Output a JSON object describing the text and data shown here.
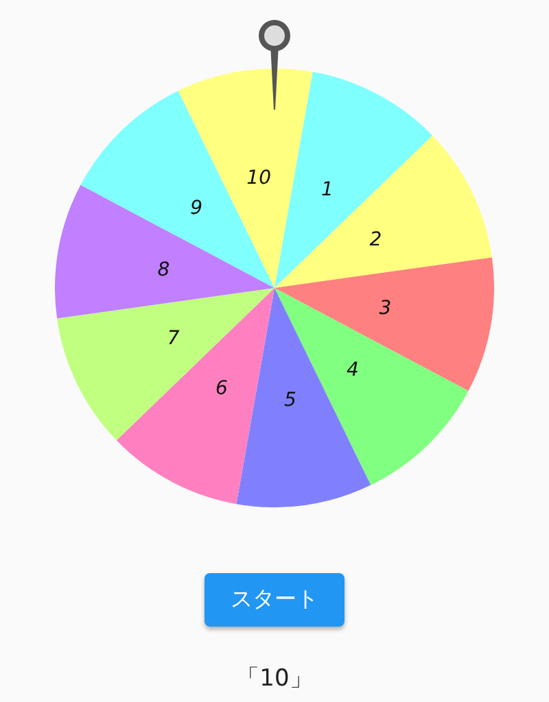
{
  "wheel": {
    "segments": [
      {
        "label": "1",
        "color": "#80ffff"
      },
      {
        "label": "2",
        "color": "#ffff80"
      },
      {
        "label": "3",
        "color": "#ff8080"
      },
      {
        "label": "4",
        "color": "#80ff80"
      },
      {
        "label": "5",
        "color": "#8080ff"
      },
      {
        "label": "6",
        "color": "#ff80c0"
      },
      {
        "label": "7",
        "color": "#c0ff80"
      },
      {
        "label": "8",
        "color": "#c080ff"
      },
      {
        "label": "9",
        "color": "#80ffff"
      },
      {
        "label": "10",
        "color": "#ffff80"
      }
    ]
  },
  "start_button": {
    "label": "スタート"
  },
  "result": "「10」"
}
